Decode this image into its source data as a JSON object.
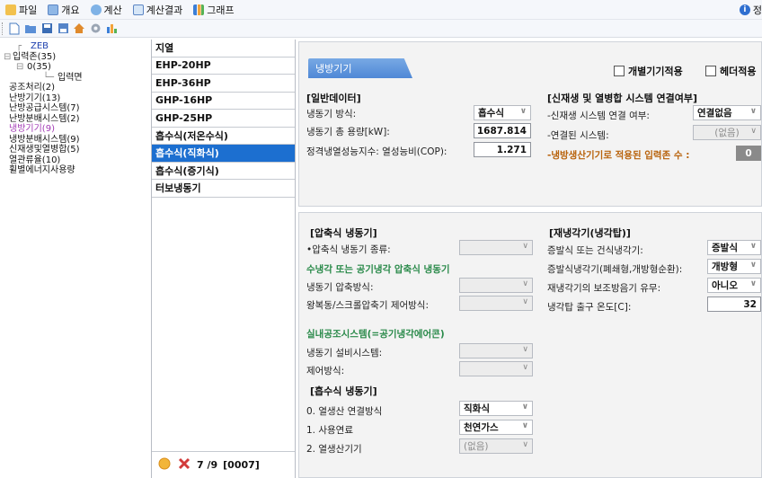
{
  "menu": {
    "file": "파일",
    "overview": "개요",
    "calc": "계산",
    "calc_result": "계산결과",
    "graph": "그래프",
    "help": "정"
  },
  "tree": {
    "root": "ZEB",
    "input_zone": "입력존(35)",
    "zone0": "0(35)",
    "input_face": "입력면",
    "air_handling": "공조처리(2)",
    "heating": "난방기기(13)",
    "heating_supply": "난방공급시스템(7)",
    "heating_dist": "난방분배시스템(2)",
    "cooling": "냉방기기(9)",
    "cooling_dist": "냉방분배시스템(9)",
    "renewable": "신재생및열병합(5)",
    "heat_recovery": "열관류율(10)",
    "total_energy": "휠별에너지사용량"
  },
  "list": {
    "items": [
      "지열",
      "EHP-20HP",
      "EHP-36HP",
      "GHP-16HP",
      "GHP-25HP",
      "흡수식(저온수식)",
      "흡수식(직화식)",
      "흡수식(증기식)",
      "터보냉동기"
    ],
    "status_page": "7 /9",
    "status_code": "[0007]"
  },
  "panel": {
    "tab": "냉방기기",
    "chk_individual": "개별기기적용",
    "chk_header": "헤더적용",
    "general": {
      "title": "[일반데이터]",
      "method_label": "냉동기 방식:",
      "method_value": "흡수식",
      "capacity_label": "냉동기 총 용량[kW]:",
      "capacity_value": "1687.814",
      "cop_label": "정격냉열성능지수: 열성능비(COP):",
      "cop_value": "1.271"
    },
    "renewable": {
      "title": "[신재생 및 열병합 시스템 연결여부]",
      "connect_label": "-신재생 시스템 연결 여부:",
      "connect_value": "연결없음",
      "connected_label": "-연결된 시스템:",
      "connected_value": "(없음)",
      "applied_label": "-냉방생산기기로 적용된 입력존 수 :",
      "applied_value": "0"
    },
    "compressor": {
      "title": "[압축식 냉동기]",
      "type_label": "•압축식 냉동기 종류:",
      "subtitle": "수냉각 또는 공기냉각 압축식 냉동기",
      "comp_method_label": "냉동기 압축방식:",
      "control_label": "왕복동/스크롤압축기 제어방식:",
      "indoor_title": "실내공조시스템(=공기냉각에어콘)",
      "facility_label": "냉동기 설비시스템:",
      "control2_label": "제어방식:"
    },
    "absorption": {
      "title": "[흡수식 냉동기]",
      "connect_label": "0. 열생산 연결방식",
      "connect_value": "직화식",
      "fuel_label": "1. 사용연료",
      "fuel_value": "천연가스",
      "producer_label": "2. 열생산기기",
      "producer_value": "(없음)"
    },
    "recooler": {
      "title": "[재냉각기(냉각탑)]",
      "type_label": "증발식 또는 건식냉각기:",
      "type_value": "증발식",
      "evap_label": "증발식냉각기(폐쇄형,개방형순환):",
      "evap_value": "개방형",
      "aux_label": "재냉각기의 보조방음기 유무:",
      "aux_value": "아니오",
      "temp_label": "냉각탑 출구 온도[C]:",
      "temp_value": "32"
    }
  }
}
